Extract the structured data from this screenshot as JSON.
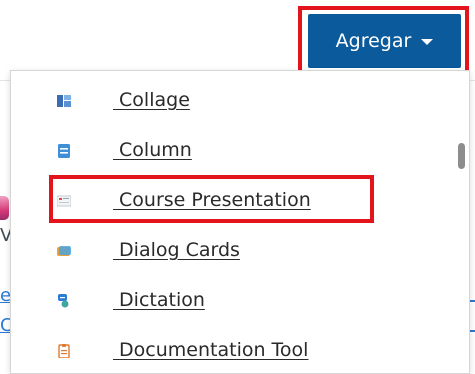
{
  "toolbar": {
    "add_label": "Agregar"
  },
  "menu": {
    "items": [
      {
        "label": " Collage",
        "icon": "collage-icon",
        "color": "#3a6db5"
      },
      {
        "label": " Column",
        "icon": "column-icon",
        "color": "#3d8fd6"
      },
      {
        "label": " Course Presentation",
        "icon": "course-presentation-icon",
        "color": "#9aa5b0",
        "highlighted": true
      },
      {
        "label": " Dialog Cards",
        "icon": "dialog-cards-icon",
        "color": "#e8a13a"
      },
      {
        "label": " Dictation",
        "icon": "dictation-icon",
        "color": "#2b7bd6"
      },
      {
        "label": " Documentation Tool",
        "icon": "documentation-tool-icon",
        "color": "#e07a2e"
      }
    ]
  },
  "colors": {
    "button_bg": "#0a5a9c",
    "highlight_border": "#e4141c",
    "text": "#2a2a2a"
  }
}
